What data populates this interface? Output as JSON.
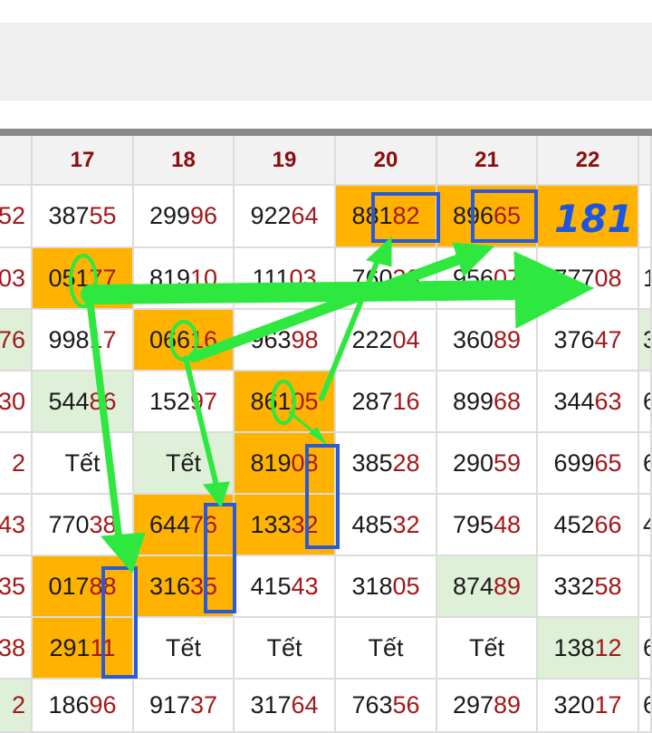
{
  "columns": [
    "17",
    "18",
    "19",
    "20",
    "21",
    "22"
  ],
  "left_edge": [
    "52",
    "03",
    "76",
    "30",
    "2",
    "43",
    "35",
    "38",
    "2"
  ],
  "right_edge": [
    "",
    "1",
    "3",
    "6",
    "6",
    "4",
    "",
    "6",
    "6"
  ],
  "rows": [
    [
      {
        "pre": "387",
        "end": "55",
        "bg": ""
      },
      {
        "pre": "299",
        "end": "96",
        "bg": ""
      },
      {
        "pre": "922",
        "end": "64",
        "bg": ""
      },
      {
        "pre": "881",
        "end": "82",
        "bg": "orange"
      },
      {
        "pre": "896",
        "end": "65",
        "bg": "orange"
      },
      {
        "pre": "",
        "end": "",
        "bg": "orange"
      }
    ],
    [
      {
        "pre": "051",
        "end": "77",
        "bg": "orange"
      },
      {
        "pre": "819",
        "end": "10",
        "bg": ""
      },
      {
        "pre": "111",
        "end": "03",
        "bg": ""
      },
      {
        "pre": "760",
        "end": "36",
        "bg": ""
      },
      {
        "pre": "956",
        "end": "07",
        "bg": ""
      },
      {
        "pre": "777",
        "end": "08",
        "bg": ""
      }
    ],
    [
      {
        "pre": "998",
        "end": "17",
        "bg": ""
      },
      {
        "pre": "066",
        "end": "16",
        "bg": "orange"
      },
      {
        "pre": "963",
        "end": "98",
        "bg": ""
      },
      {
        "pre": "222",
        "end": "04",
        "bg": ""
      },
      {
        "pre": "360",
        "end": "89",
        "bg": ""
      },
      {
        "pre": "376",
        "end": "47",
        "bg": ""
      }
    ],
    [
      {
        "pre": "544",
        "end": "86",
        "bg": "green"
      },
      {
        "pre": "152",
        "end": "97",
        "bg": ""
      },
      {
        "pre": "861",
        "end": "05",
        "bg": "orange"
      },
      {
        "pre": "287",
        "end": "16",
        "bg": ""
      },
      {
        "pre": "899",
        "end": "68",
        "bg": ""
      },
      {
        "pre": "344",
        "end": "63",
        "bg": ""
      }
    ],
    [
      {
        "pre": "Tết",
        "end": "",
        "bg": ""
      },
      {
        "pre": "Tết",
        "end": "",
        "bg": "green"
      },
      {
        "pre": "819",
        "end": "08",
        "bg": "orange"
      },
      {
        "pre": "385",
        "end": "28",
        "bg": ""
      },
      {
        "pre": "290",
        "end": "59",
        "bg": ""
      },
      {
        "pre": "699",
        "end": "65",
        "bg": ""
      }
    ],
    [
      {
        "pre": "770",
        "end": "38",
        "bg": ""
      },
      {
        "pre": "644",
        "end": "76",
        "bg": "orange"
      },
      {
        "pre": "133",
        "end": "32",
        "bg": "orange"
      },
      {
        "pre": "485",
        "end": "32",
        "bg": ""
      },
      {
        "pre": "795",
        "end": "48",
        "bg": ""
      },
      {
        "pre": "452",
        "end": "66",
        "bg": ""
      }
    ],
    [
      {
        "pre": "017",
        "end": "88",
        "bg": "orange"
      },
      {
        "pre": "316",
        "end": "35",
        "bg": "orange"
      },
      {
        "pre": "415",
        "end": "43",
        "bg": ""
      },
      {
        "pre": "318",
        "end": "05",
        "bg": ""
      },
      {
        "pre": "874",
        "end": "89",
        "bg": "green"
      },
      {
        "pre": "332",
        "end": "58",
        "bg": ""
      }
    ],
    [
      {
        "pre": "291",
        "end": "11",
        "bg": "orange"
      },
      {
        "pre": "Tết",
        "end": "",
        "bg": ""
      },
      {
        "pre": "Tết",
        "end": "",
        "bg": ""
      },
      {
        "pre": "Tết",
        "end": "",
        "bg": ""
      },
      {
        "pre": "Tết",
        "end": "",
        "bg": ""
      },
      {
        "pre": "138",
        "end": "12",
        "bg": "green"
      }
    ],
    [
      {
        "pre": "186",
        "end": "96",
        "bg": ""
      },
      {
        "pre": "917",
        "end": "37",
        "bg": ""
      },
      {
        "pre": "317",
        "end": "64",
        "bg": ""
      },
      {
        "pre": "763",
        "end": "56",
        "bg": ""
      },
      {
        "pre": "297",
        "end": "89",
        "bg": ""
      },
      {
        "pre": "320",
        "end": "17",
        "bg": ""
      }
    ]
  ],
  "annotation": {
    "handwritten": "181"
  },
  "colors": {
    "highlight": "#ffb300",
    "green_cell": "#dff0d8",
    "header_text": "#8b0d0d",
    "digit_red": "#a3171a",
    "arrow": "#2ee83f",
    "box": "#2b5ad8"
  }
}
